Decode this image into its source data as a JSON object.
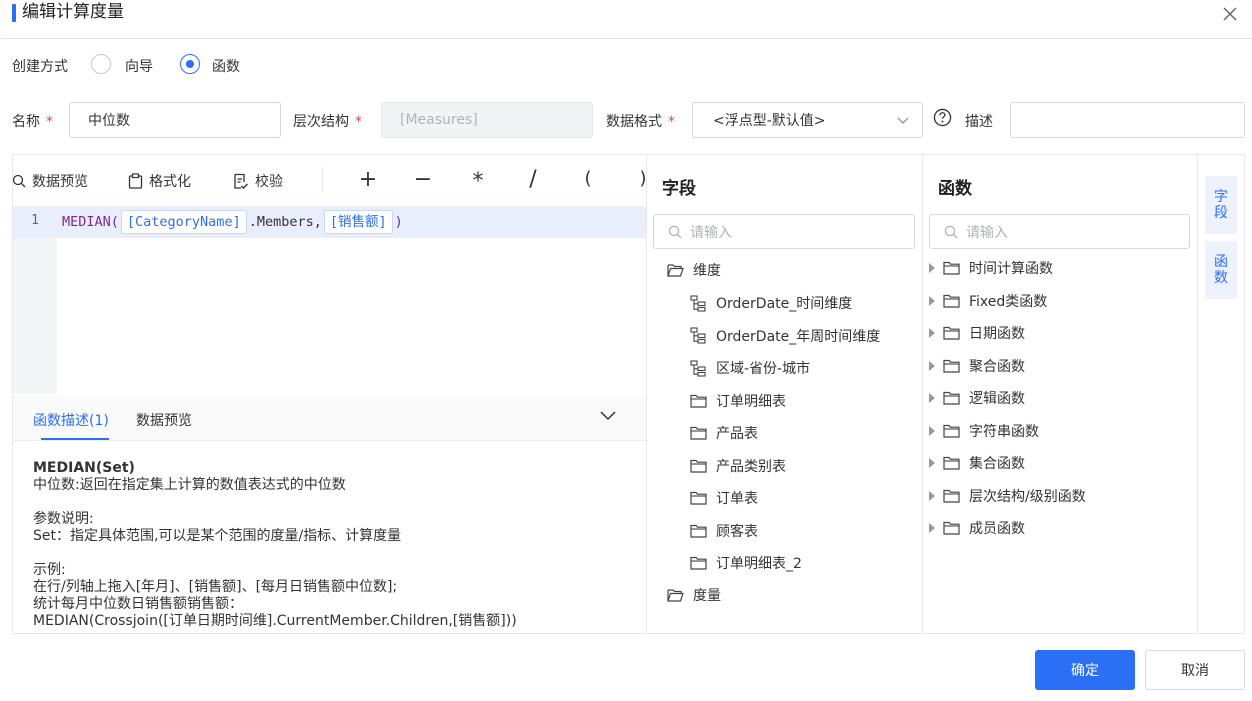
{
  "dialog": {
    "title": "编辑计算度量"
  },
  "create_method": {
    "label": "创建方式",
    "options": [
      {
        "label": "向导",
        "selected": false
      },
      {
        "label": "函数",
        "selected": true
      }
    ]
  },
  "form": {
    "name_label": "名称",
    "name_value": "中位数",
    "hierarchy_label": "层次结构",
    "hierarchy_value": "[Measures]",
    "format_label": "数据格式",
    "format_value": "<浮点型-默认值>",
    "desc_label": "描述",
    "desc_value": "",
    "required_mark": "*"
  },
  "toolbar": {
    "preview": "数据预览",
    "format": "格式化",
    "validate": "校验",
    "operators": [
      "+",
      "−",
      "*",
      "/",
      "(",
      ")"
    ]
  },
  "editor": {
    "line_number": "1",
    "fn_open": "MEDIAN(",
    "token1": "[CategoryName]",
    "mid": ".Members,",
    "token2": "[销售额]",
    "close": ")"
  },
  "bottom_tabs": {
    "tab1": "函数描述(1)",
    "tab2": "数据预览"
  },
  "description": {
    "signature": "MEDIAN(Set)",
    "summary": "中位数:返回在指定集上计算的数值表达式的中位数",
    "params_title": "参数说明:",
    "params_set": "Set：指定具体范围,可以是某个范围的度量/指标、计算度量",
    "example_title": "示例:",
    "example_line1": "在行/列轴上拖入[年月]、[销售额]、[每月日销售额中位数];",
    "example_line2": "统计每月中位数日销售额销售额：",
    "example_line3": "MEDIAN(Crossjoin([订单日期时间维].CurrentMember.Children,[销售额]))"
  },
  "fields_panel": {
    "title": "字段",
    "search_placeholder": "请输入",
    "dimension_root": "维度",
    "items": [
      {
        "label": "OrderDate_时间维度",
        "icon": "hierarchy-icon"
      },
      {
        "label": "OrderDate_年周时间维度",
        "icon": "hierarchy-icon"
      },
      {
        "label": "区域-省份-城市",
        "icon": "hierarchy-icon"
      },
      {
        "label": "订单明细表",
        "icon": "folder-icon"
      },
      {
        "label": "产品表",
        "icon": "folder-icon"
      },
      {
        "label": "产品类别表",
        "icon": "folder-icon"
      },
      {
        "label": "订单表",
        "icon": "folder-icon"
      },
      {
        "label": "顾客表",
        "icon": "folder-icon"
      },
      {
        "label": "订单明细表_2",
        "icon": "folder-icon"
      }
    ],
    "measure_root": "度量"
  },
  "functions_panel": {
    "title": "函数",
    "search_placeholder": "请输入",
    "items": [
      "时间计算函数",
      "Fixed类函数",
      "日期函数",
      "聚合函数",
      "逻辑函数",
      "字符串函数",
      "集合函数",
      "层次结构/级别函数",
      "成员函数"
    ]
  },
  "side_tabs": {
    "fields": "字段",
    "functions": "函数"
  },
  "footer": {
    "ok": "确定",
    "cancel": "取消"
  },
  "colors": {
    "accent": "#2a6ff6",
    "required": "#e6463c"
  }
}
